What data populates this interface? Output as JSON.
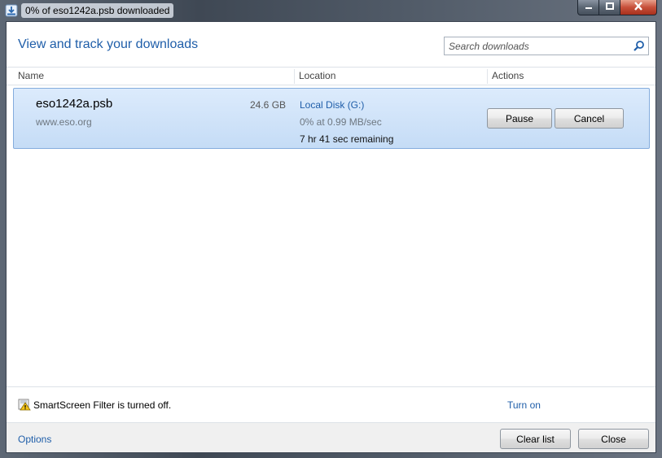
{
  "window": {
    "title": "0% of eso1242a.psb downloaded",
    "app_icon": "download-manager-icon",
    "caption_icons": [
      "minimize-icon",
      "maximize-icon",
      "close-icon"
    ]
  },
  "header": {
    "title": "View and track your downloads",
    "search_placeholder": "Search downloads",
    "search_icon": "search-icon"
  },
  "columns": {
    "name": "Name",
    "location": "Location",
    "actions": "Actions"
  },
  "downloads": [
    {
      "file_name": "eso1242a.psb",
      "size": "24.6 GB",
      "source": "www.eso.org",
      "location": "Local Disk (G:)",
      "progress": "0% at 0.99 MB/sec",
      "remaining": "7 hr 41 sec remaining",
      "pause_label": "Pause",
      "cancel_label": "Cancel"
    }
  ],
  "smartscreen": {
    "icon": "warning-shield-icon",
    "text": "SmartScreen Filter is turned off.",
    "turn_on_label": "Turn on"
  },
  "footer": {
    "options_label": "Options",
    "clear_label": "Clear list",
    "close_label": "Close"
  },
  "colors": {
    "accent": "#1f5ea9",
    "row_selected": "#cfe3f8",
    "row_border": "#84acdd"
  }
}
